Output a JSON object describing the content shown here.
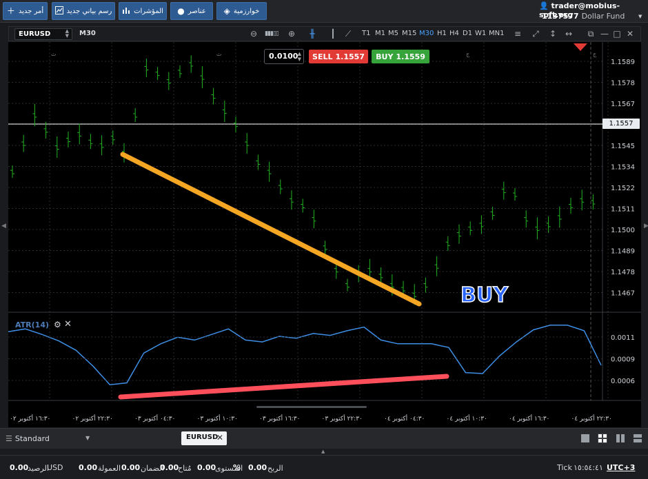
{
  "toolbar": {
    "new_order": "أمر جديد",
    "new_chart": "رسم بياني جديد",
    "indicators": "المؤشرات",
    "elements": "عناصر",
    "algorithms": "خوارزمية"
  },
  "account": {
    "user": "trader@mobius-soft.org",
    "number": "1137577",
    "fund": "Dollar Fund"
  },
  "chart_toolbar": {
    "symbol": "EURUSD",
    "timeframe": "M30",
    "timeframes": [
      "T1",
      "M1",
      "M5",
      "M15",
      "M30",
      "H1",
      "H4",
      "D1",
      "W1",
      "MN1"
    ],
    "active_timeframe": "M30"
  },
  "order": {
    "lot": "0.0100",
    "sell_label": "SELL",
    "sell_price": "1.1557",
    "buy_label": "BUY",
    "buy_price": "1.1559"
  },
  "price_axis": {
    "labels": [
      "1.1589",
      "1.1578",
      "1.1567",
      "1.1557",
      "1.1545",
      "1.1534",
      "1.1522",
      "1.1511",
      "1.1500",
      "1.1489",
      "1.1478",
      "1.1467"
    ],
    "current": "1.1557"
  },
  "atr": {
    "label": "ATR(14)",
    "axis_labels": [
      "0.0011",
      "0.0009",
      "0.0006"
    ]
  },
  "time_axis": [
    "١٦:٣٠ أكتوبر ٠٢",
    "٢٢:٣٠ أكتوبر ٠٢",
    "٠٤:٣٠ أكتوبر ٠٣",
    "١٠:٣٠ أكتوبر ٠٣",
    "١٦:٣٠ أكتوبر ٠٣",
    "٢٢:٣٠ أكتوبر ٠٣",
    "٠٤:٣٠ أكتوبر ٠٤",
    "١٠:٣٠ أكتوبر ٠٤",
    "١٦:٣٠ أكتوبر ٠٤",
    "٢٢:٣٠ أكتوبر ٠٤"
  ],
  "annotation": "BUY",
  "colors": {
    "bull_bar": "#1fb51f",
    "trend_orange": "#f5a623",
    "trend_red": "#ff4f5a",
    "atr_line": "#3d8fe6",
    "sell": "#e23a35",
    "buy": "#36a43b"
  },
  "chart_data": {
    "type": "line",
    "series": [
      {
        "values": [
          1.153,
          1.1545,
          1.156,
          1.1552,
          1.1543,
          1.1547,
          1.155,
          1.1546,
          1.1544,
          1.1548,
          1.154,
          1.156,
          1.1585,
          1.1582,
          1.1578,
          1.1583,
          1.1587,
          1.158,
          1.157,
          1.1562,
          1.1555,
          1.1545,
          1.1535,
          1.153,
          1.1522,
          1.1515,
          1.1512,
          1.1505,
          1.149,
          1.1478,
          1.147,
          1.1476,
          1.1478,
          1.1475,
          1.147,
          1.1468,
          1.1465,
          1.147,
          1.148,
          1.1492,
          1.1497,
          1.15,
          1.1502,
          1.1508,
          1.152,
          1.1518,
          1.1505,
          1.15,
          1.1502,
          1.1506,
          1.1512,
          1.1515,
          1.1514
        ]
      },
      {
        "name": "ATR(14)",
        "values": [
          0.00115,
          0.00118,
          0.00112,
          0.00105,
          0.00095,
          0.00078,
          0.00058,
          0.0006,
          0.00092,
          0.00102,
          0.00109,
          0.00106,
          0.00112,
          0.00118,
          0.00106,
          0.00104,
          0.0011,
          0.00108,
          0.00113,
          0.00111,
          0.00116,
          0.0012,
          0.00106,
          0.00102,
          0.00102,
          0.00102,
          0.00098,
          0.00071,
          0.0007,
          0.00089,
          0.00104,
          0.00117,
          0.00122,
          0.00122,
          0.00116,
          0.00079
        ]
      }
    ],
    "ylim": [
      1.146,
      1.1595
    ],
    "atr_ylim": [
      0.0005,
      0.0013
    ]
  },
  "bottom": {
    "template": "Standard",
    "symbol_tab": "EURUSD"
  },
  "status": {
    "balance_label": "الرصيد",
    "balance": "0.00",
    "currency": "USD",
    "commission_label": "العمولة",
    "commission": "0.00",
    "margin_label": "الضمان",
    "margin": "0.00",
    "free_label": "مُتاح",
    "free": "0.00",
    "level_label": "المستوى",
    "level": "%",
    "profit_label": "الربح",
    "profit": "0.00",
    "tick": "Tick",
    "time": "١٥:٥٤:٤١",
    "tz": "UTC+3"
  }
}
